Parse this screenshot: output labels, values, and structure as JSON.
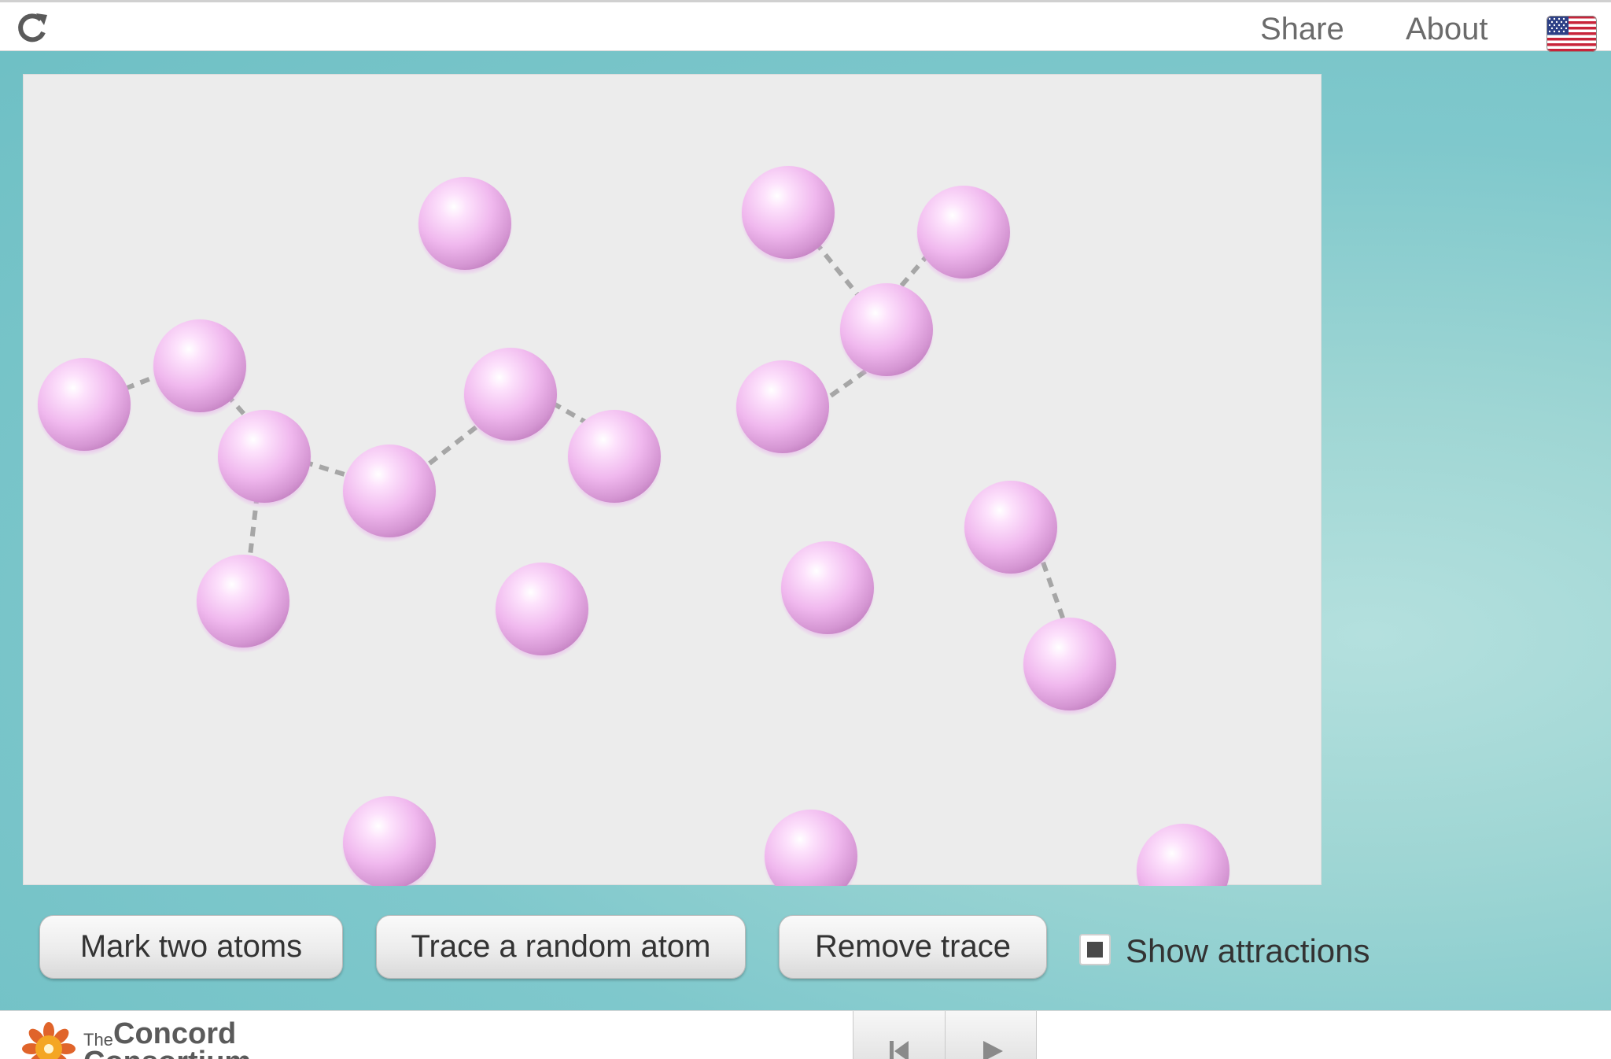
{
  "topbar": {
    "reload_icon": "reload-icon",
    "share_label": "Share",
    "about_label": "About",
    "language_flag_icon": "us-flag-icon"
  },
  "simulation": {
    "atom_color": "#f0b8ee",
    "bond_color": "#a6a6a6",
    "background_color": "#ececec",
    "atom_count": 21
  },
  "controls": {
    "mark_two_atoms_label": "Mark two atoms",
    "trace_random_atom_label": "Trace a random atom",
    "remove_trace_label": "Remove trace",
    "show_attractions_label": "Show attractions",
    "show_attractions_checked": true
  },
  "footer": {
    "logo_the": "The",
    "logo_name": "Concord",
    "logo_sub": "Consortium",
    "restart_icon": "skip-to-start-icon",
    "play_icon": "play-icon"
  },
  "colors": {
    "accent_teal": "#7fc8cc",
    "topbar_text": "#6b6b6b"
  }
}
